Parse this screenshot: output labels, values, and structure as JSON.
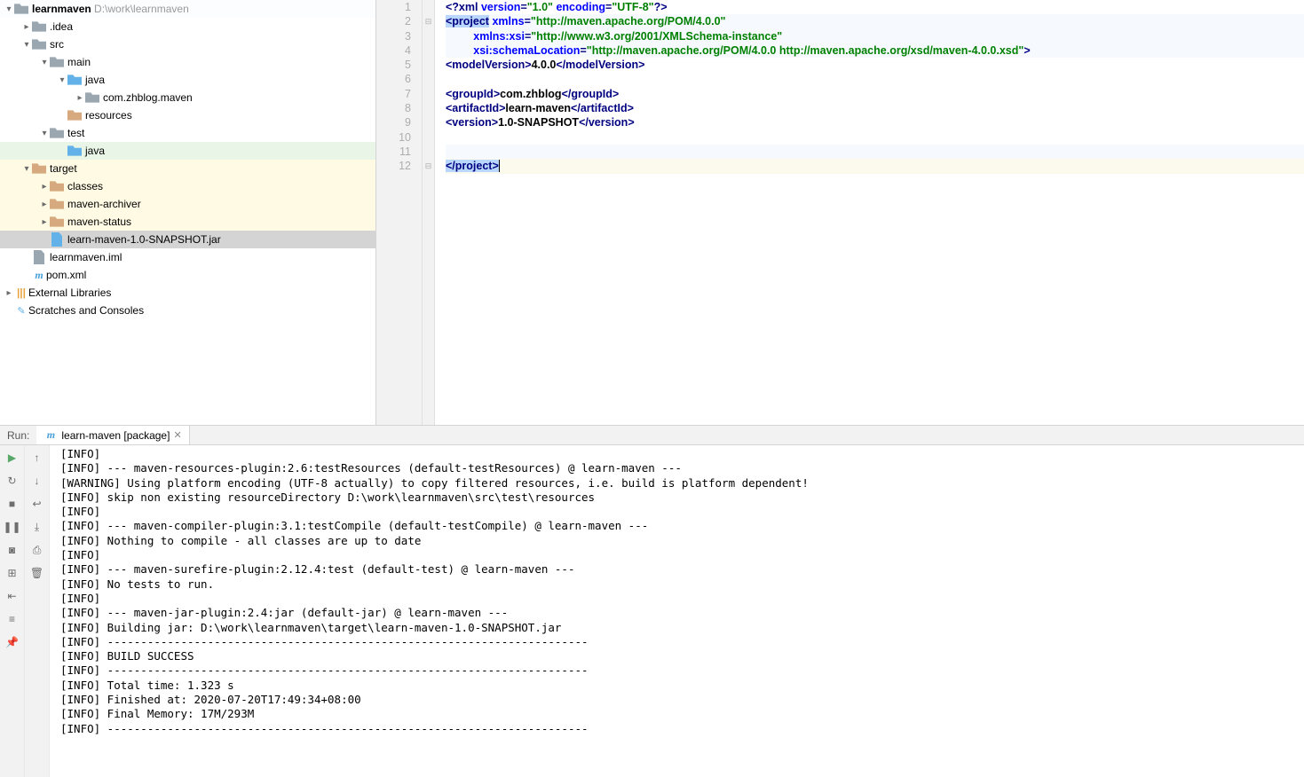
{
  "project": {
    "root": {
      "name": "learnmaven",
      "path": "D:\\work\\learnmaven"
    },
    "tree": [
      {
        "depth": 0,
        "tw": "v",
        "icon": "folder",
        "label": "learnmaven",
        "extra": "D:\\work\\learnmaven",
        "bold": true
      },
      {
        "depth": 1,
        "tw": ">",
        "icon": "folder",
        "label": ".idea"
      },
      {
        "depth": 1,
        "tw": "v",
        "icon": "folder",
        "label": "src"
      },
      {
        "depth": 2,
        "tw": "v",
        "icon": "folder",
        "label": "main"
      },
      {
        "depth": 3,
        "tw": "v",
        "icon": "folder-blu",
        "label": "java"
      },
      {
        "depth": 4,
        "tw": ">",
        "icon": "folder",
        "label": "com.zhblog.maven"
      },
      {
        "depth": 3,
        "tw": "",
        "icon": "folder-brn",
        "label": "resources"
      },
      {
        "depth": 2,
        "tw": "v",
        "icon": "folder",
        "label": "test"
      },
      {
        "depth": 3,
        "tw": "",
        "icon": "folder-blu",
        "label": "java",
        "greenrow": true
      },
      {
        "depth": 1,
        "tw": "v",
        "icon": "folder-brn",
        "label": "target",
        "hl": true
      },
      {
        "depth": 2,
        "tw": ">",
        "icon": "folder-brn",
        "label": "classes",
        "hl": true
      },
      {
        "depth": 2,
        "tw": ">",
        "icon": "folder-brn",
        "label": "maven-archiver",
        "hl": true
      },
      {
        "depth": 2,
        "tw": ">",
        "icon": "folder-brn",
        "label": "maven-status",
        "hl": true
      },
      {
        "depth": 2,
        "tw": "",
        "icon": "file-blue",
        "label": "learn-maven-1.0-SNAPSHOT.jar",
        "sel": true
      },
      {
        "depth": 1,
        "tw": "",
        "icon": "file-grey",
        "label": "learnmaven.iml"
      },
      {
        "depth": 1,
        "tw": "",
        "icon": "m",
        "label": "pom.xml"
      },
      {
        "depth": 0,
        "tw": ">",
        "icon": "lib",
        "label": "External Libraries"
      },
      {
        "depth": 0,
        "tw": "",
        "icon": "scratch",
        "label": "Scratches and Consoles"
      }
    ]
  },
  "editor": {
    "lines": [
      {
        "n": 1,
        "bg": "",
        "html": "<span class='kw'>&lt;?xml</span> <span class='attr'>version</span><span class='kw'>=</span><span class='str'>\"1.0\"</span> <span class='attr'>encoding</span><span class='kw'>=</span><span class='str'>\"UTF-8\"</span><span class='kw'>?&gt;</span>"
      },
      {
        "n": 2,
        "bg": "bg1",
        "html": "<span class='sel'><span class='kw'>&lt;project</span></span> <span class='attr'>xmlns</span><span class='kw'>=</span><span class='str'>\"http://maven.apache.org/POM/4.0.0\"</span>",
        "fold": "⊟"
      },
      {
        "n": 3,
        "bg": "bg1",
        "html": "         <span class='attr'>xmlns:xsi</span><span class='kw'>=</span><span class='str'>\"http://www.w3.org/2001/XMLSchema-instance\"</span>"
      },
      {
        "n": 4,
        "bg": "bg1",
        "html": "         <span class='attr'>xsi:schemaLocation</span><span class='kw'>=</span><span class='str'>\"http://maven.apache.org/POM/4.0.0 http://maven.apache.org/xsd/maven-4.0.0.xsd\"</span><span class='kw'>&gt;</span>"
      },
      {
        "n": 5,
        "bg": "",
        "html": "<span class='kw'>&lt;modelVersion&gt;</span><span class='txt'>4.0.0</span><span class='kw'>&lt;/modelVersion&gt;</span>"
      },
      {
        "n": 6,
        "bg": "",
        "html": ""
      },
      {
        "n": 7,
        "bg": "",
        "html": "<span class='kw'>&lt;groupId&gt;</span><span class='txt'>com.zhblog</span><span class='kw'>&lt;/groupId&gt;</span>"
      },
      {
        "n": 8,
        "bg": "",
        "html": "<span class='kw'>&lt;artifactId&gt;</span><span class='txt'>learn-maven</span><span class='kw'>&lt;/artifactId&gt;</span>"
      },
      {
        "n": 9,
        "bg": "",
        "html": "<span class='kw'>&lt;version&gt;</span><span class='txt'>1.0-SNAPSHOT</span><span class='kw'>&lt;/version&gt;</span>"
      },
      {
        "n": 10,
        "bg": "",
        "html": ""
      },
      {
        "n": 11,
        "bg": "bg1",
        "html": ""
      },
      {
        "n": 12,
        "bg": "caret-ln",
        "html": "<span class='sel'><span class='kw'>&lt;/project&gt;</span></span><span class='caret'></span>",
        "fold": "⊟"
      }
    ]
  },
  "run": {
    "label": "Run:",
    "tab": "learn-maven [package]",
    "console": [
      "[INFO]",
      "[INFO] --- maven-resources-plugin:2.6:testResources (default-testResources) @ learn-maven ---",
      "[WARNING] Using platform encoding (UTF-8 actually) to copy filtered resources, i.e. build is platform dependent!",
      "[INFO] skip non existing resourceDirectory D:\\work\\learnmaven\\src\\test\\resources",
      "[INFO]",
      "[INFO] --- maven-compiler-plugin:3.1:testCompile (default-testCompile) @ learn-maven ---",
      "[INFO] Nothing to compile - all classes are up to date",
      "[INFO]",
      "[INFO] --- maven-surefire-plugin:2.12.4:test (default-test) @ learn-maven ---",
      "[INFO] No tests to run.",
      "[INFO]",
      "[INFO] --- maven-jar-plugin:2.4:jar (default-jar) @ learn-maven ---",
      "[INFO] Building jar: D:\\work\\learnmaven\\target\\learn-maven-1.0-SNAPSHOT.jar",
      "[INFO] ------------------------------------------------------------------------",
      "[INFO] BUILD SUCCESS",
      "[INFO] ------------------------------------------------------------------------",
      "[INFO] Total time: 1.323 s",
      "[INFO] Finished at: 2020-07-20T17:49:34+08:00",
      "[INFO] Final Memory: 17M/293M",
      "[INFO] ------------------------------------------------------------------------"
    ],
    "tool_icons_col1": [
      "play",
      "rerun",
      "stop",
      "pause",
      "camera",
      "layout",
      "exit",
      "stack",
      "pin"
    ],
    "tool_icons_col2": [
      "up",
      "down",
      "wrap",
      "scroll",
      "print",
      "trash"
    ]
  }
}
